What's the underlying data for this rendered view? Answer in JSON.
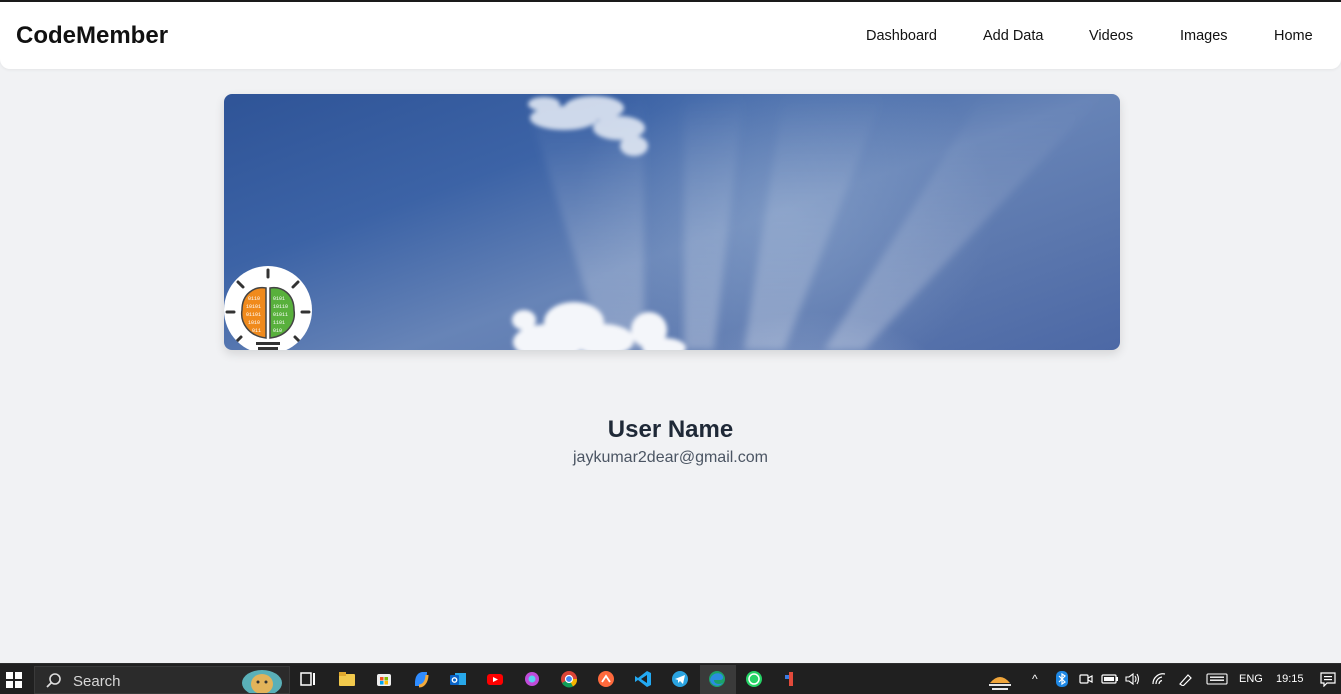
{
  "navbar": {
    "brand": "CodeMember",
    "links": [
      "Dashboard",
      "Add Data",
      "Videos",
      "Images",
      "Home"
    ]
  },
  "profile": {
    "cover_image": "sky-with-clouds",
    "avatar_image": "brain-lightbulb-binary-logo",
    "name": "User Name",
    "email": "jaykumar2dear@gmail.com"
  },
  "taskbar": {
    "search_placeholder": "Search",
    "apps": [
      "task-view-icon",
      "file-explorer-icon",
      "store-icon",
      "copilot-icon",
      "outlook-icon",
      "youtube-icon",
      "app-icon",
      "chrome-icon",
      "app-icon",
      "vscode-icon",
      "telegram-icon",
      "edge-icon",
      "whatsapp-icon",
      "app-icon"
    ],
    "language": "ENG",
    "time": "19:15"
  }
}
